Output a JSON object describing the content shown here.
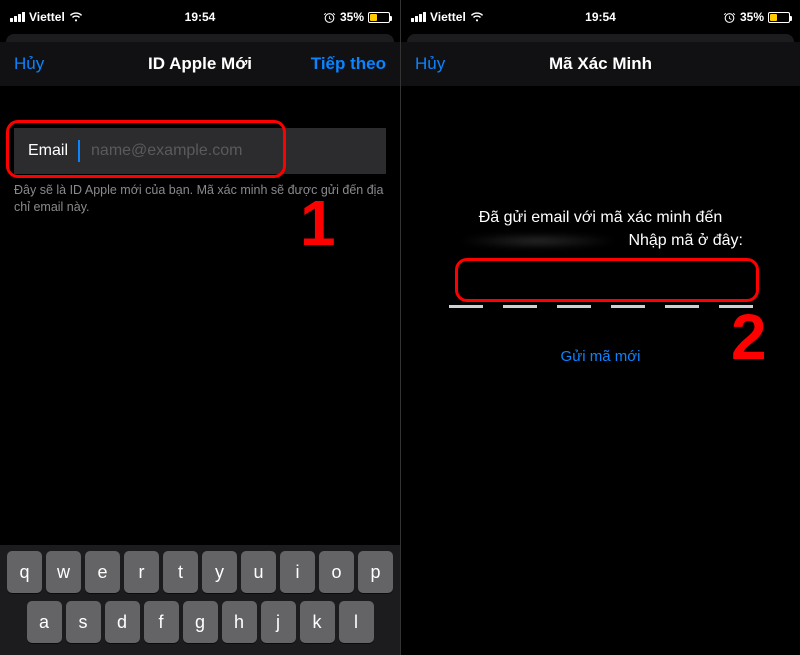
{
  "status": {
    "carrier": "Viettel",
    "time": "19:54",
    "battery_pct": "35%"
  },
  "screen1": {
    "nav": {
      "cancel": "Hủy",
      "title": "ID Apple Mới",
      "next": "Tiếp theo"
    },
    "field": {
      "label": "Email",
      "placeholder": "name@example.com"
    },
    "helper": "Đây sẽ là ID Apple mới của bạn. Mã xác minh sẽ được gửi đến địa chỉ email này.",
    "annotation_number": "1"
  },
  "screen2": {
    "nav": {
      "cancel": "Hủy",
      "title": "Mã Xác Minh"
    },
    "msg_line1": "Đã gửi email với mã xác minh đến",
    "msg_suffix": "Nhập mã ở đây:",
    "resend": "Gửi mã mới",
    "annotation_number": "2",
    "code_length": 6
  },
  "keyboard": {
    "row1": [
      "q",
      "w",
      "e",
      "r",
      "t",
      "y",
      "u",
      "i",
      "o",
      "p"
    ],
    "row2": [
      "a",
      "s",
      "d",
      "f",
      "g",
      "h",
      "j",
      "k",
      "l"
    ]
  }
}
